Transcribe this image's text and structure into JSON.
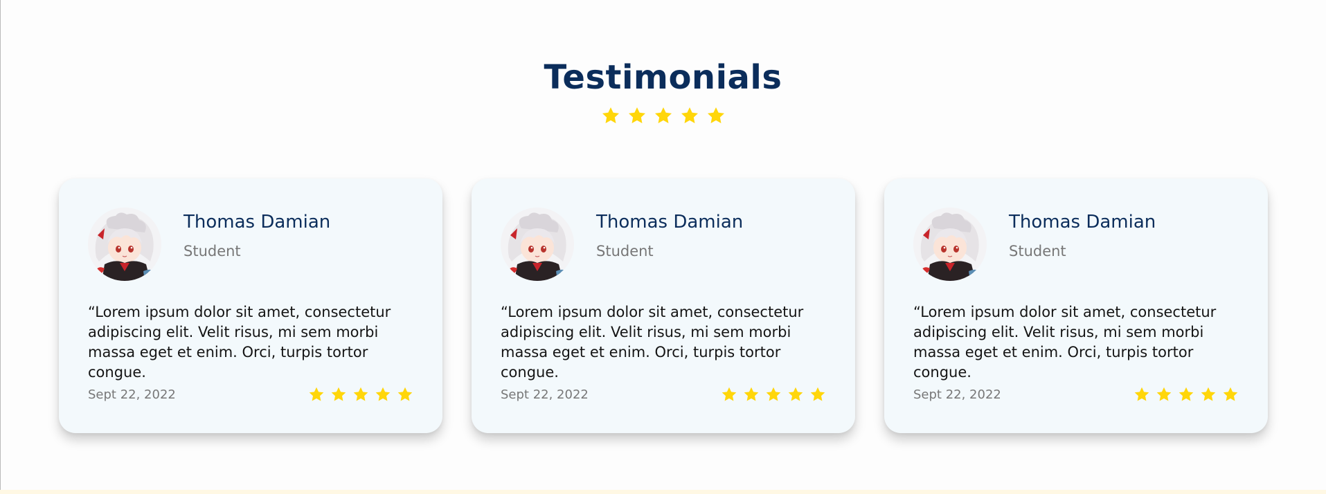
{
  "section": {
    "title": "Testimonials",
    "rating": 5,
    "star_color": "#FFD60A"
  },
  "testimonials": [
    {
      "name": "Thomas Damian",
      "role": "Student",
      "quote": "“Lorem ipsum dolor sit amet, consectetur adipiscing elit. Velit risus, mi sem morbi massa eget et enim. Orci, turpis tortor congue.",
      "date": "Sept 22, 2022",
      "rating": 5
    },
    {
      "name": "Thomas Damian",
      "role": "Student",
      "quote": "“Lorem ipsum dolor sit amet, consectetur adipiscing elit. Velit risus, mi sem morbi massa eget et enim. Orci, turpis tortor congue.",
      "date": "Sept 22, 2022",
      "rating": 5
    },
    {
      "name": "Thomas Damian",
      "role": "Student",
      "quote": "“Lorem ipsum dolor sit amet, consectetur adipiscing elit. Velit risus, mi sem morbi massa eget et enim. Orci, turpis tortor congue.",
      "date": "Sept 22, 2022",
      "rating": 5
    }
  ],
  "colors": {
    "title": "#0B2D5B",
    "card_background": "#F3F9FC",
    "muted_text": "#777777"
  },
  "icons": {
    "star": "star-icon",
    "avatar": "anime-character-avatar"
  }
}
